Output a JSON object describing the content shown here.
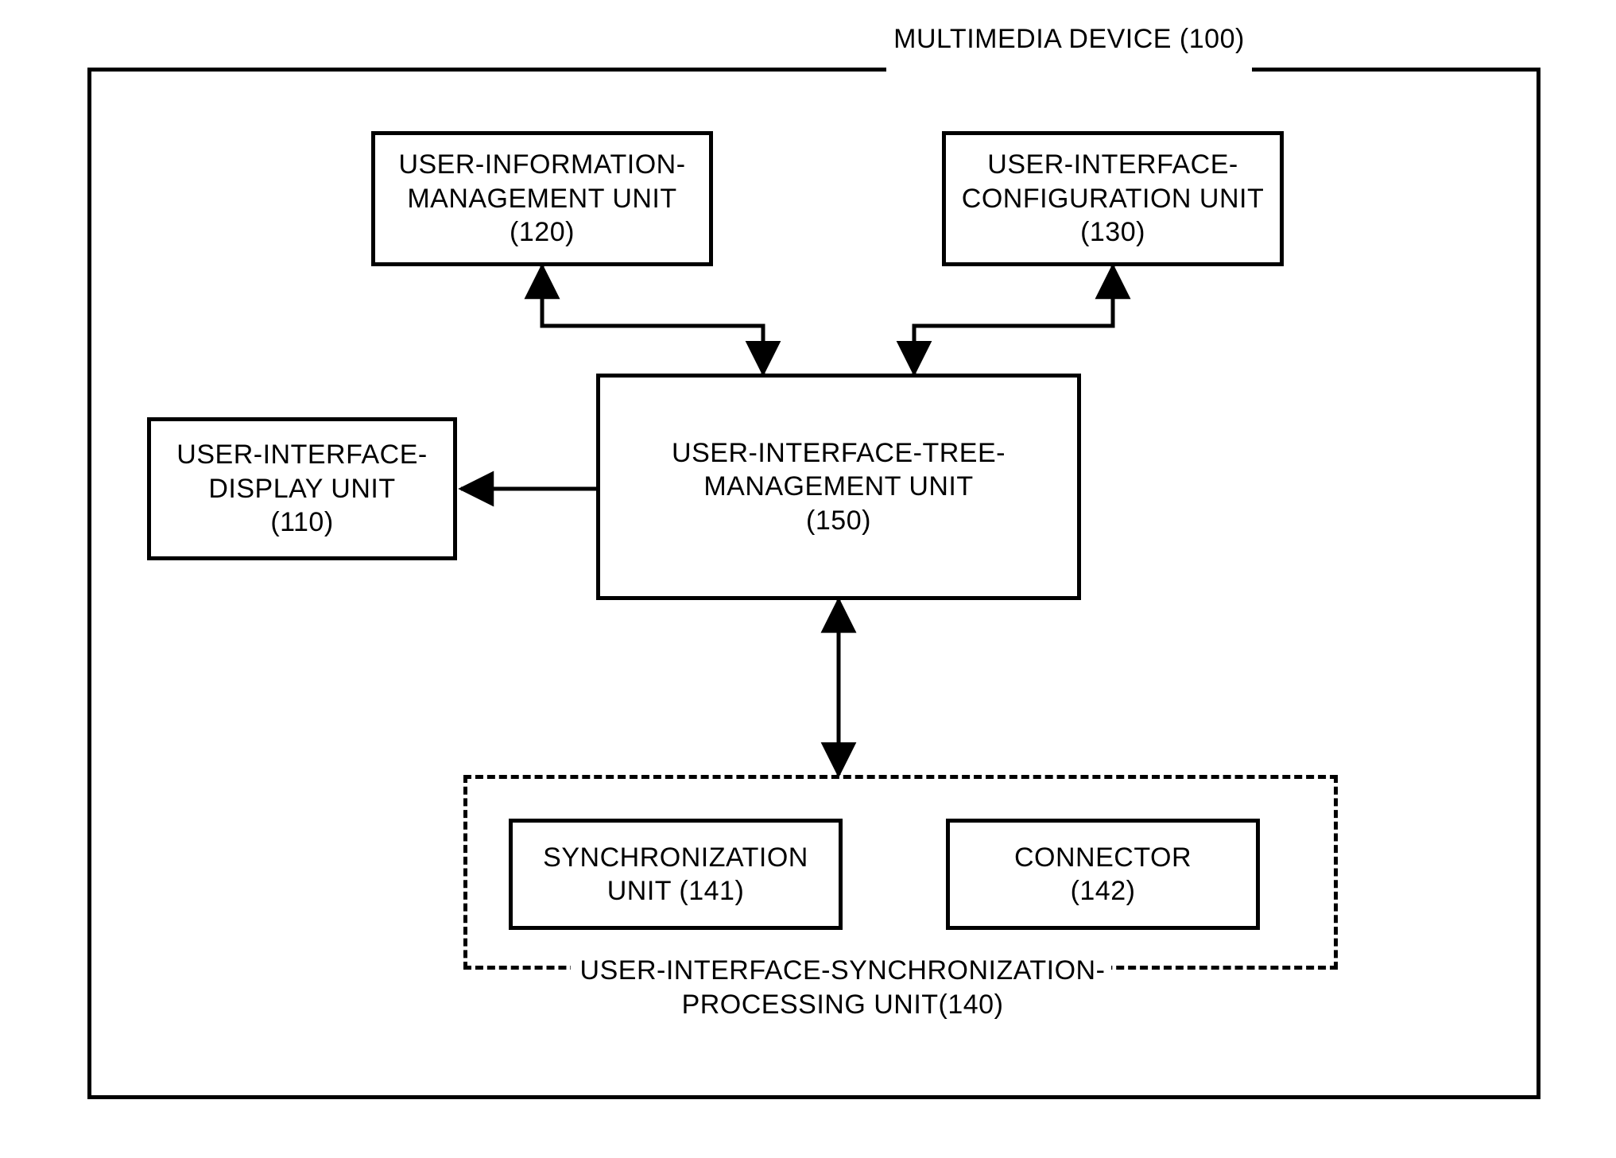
{
  "diagram": {
    "title": "MULTIMEDIA DEVICE (100)",
    "blocks": {
      "user_info_mgmt": "USER-INFORMATION-\nMANAGEMENT UNIT\n(120)",
      "ui_config": "USER-INTERFACE-\nCONFIGURATION UNIT\n(130)",
      "ui_display": "USER-INTERFACE-\nDISPLAY UNIT\n(110)",
      "ui_tree_mgmt": "USER-INTERFACE-TREE-\nMANAGEMENT UNIT\n(150)",
      "sync_unit": "SYNCHRONIZATION\nUNIT (141)",
      "connector": "CONNECTOR\n(142)"
    },
    "sync_group_label": "USER-INTERFACE-SYNCHRONIZATION-\nPROCESSING UNIT(140)"
  }
}
